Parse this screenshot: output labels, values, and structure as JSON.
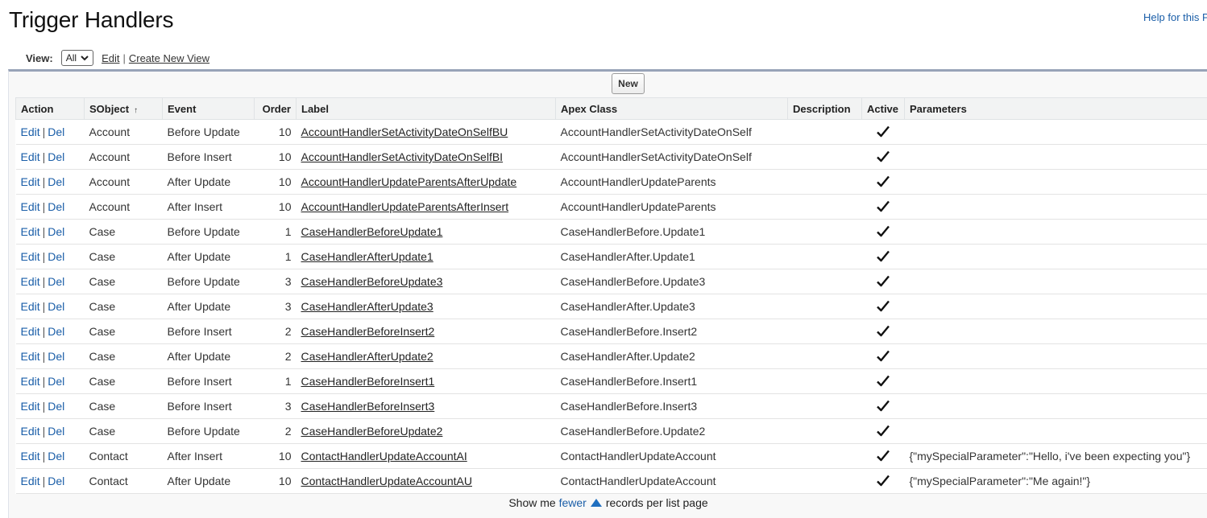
{
  "page": {
    "title": "Trigger Handlers",
    "help_link": "Help for this Page"
  },
  "viewbar": {
    "label": "View:",
    "selected": "All",
    "edit_link": "Edit",
    "separator": "|",
    "create_link": "Create New View"
  },
  "toolbar": {
    "new_label": "New"
  },
  "columns": {
    "action": "Action",
    "sobject": "SObject",
    "event": "Event",
    "order": "Order",
    "label": "Label",
    "apex_class": "Apex Class",
    "description": "Description",
    "active": "Active",
    "parameters": "Parameters"
  },
  "row_actions": {
    "edit": "Edit",
    "sep": "|",
    "del": "Del"
  },
  "rows": [
    {
      "sobject": "Account",
      "event": "Before Update",
      "order": "10",
      "label": "AccountHandlerSetActivityDateOnSelfBU",
      "apex_class": "AccountHandlerSetActivityDateOnSelf",
      "description": "",
      "active": true,
      "parameters": ""
    },
    {
      "sobject": "Account",
      "event": "Before Insert",
      "order": "10",
      "label": "AccountHandlerSetActivityDateOnSelfBI",
      "apex_class": "AccountHandlerSetActivityDateOnSelf",
      "description": "",
      "active": true,
      "parameters": ""
    },
    {
      "sobject": "Account",
      "event": "After Update",
      "order": "10",
      "label": "AccountHandlerUpdateParentsAfterUpdate",
      "apex_class": "AccountHandlerUpdateParents",
      "description": "",
      "active": true,
      "parameters": ""
    },
    {
      "sobject": "Account",
      "event": "After Insert",
      "order": "10",
      "label": "AccountHandlerUpdateParentsAfterInsert",
      "apex_class": "AccountHandlerUpdateParents",
      "description": "",
      "active": true,
      "parameters": ""
    },
    {
      "sobject": "Case",
      "event": "Before Update",
      "order": "1",
      "label": "CaseHandlerBeforeUpdate1",
      "apex_class": "CaseHandlerBefore.Update1",
      "description": "",
      "active": true,
      "parameters": ""
    },
    {
      "sobject": "Case",
      "event": "After Update",
      "order": "1",
      "label": "CaseHandlerAfterUpdate1",
      "apex_class": "CaseHandlerAfter.Update1",
      "description": "",
      "active": true,
      "parameters": ""
    },
    {
      "sobject": "Case",
      "event": "Before Update",
      "order": "3",
      "label": "CaseHandlerBeforeUpdate3",
      "apex_class": "CaseHandlerBefore.Update3",
      "description": "",
      "active": true,
      "parameters": ""
    },
    {
      "sobject": "Case",
      "event": "After Update",
      "order": "3",
      "label": "CaseHandlerAfterUpdate3",
      "apex_class": "CaseHandlerAfter.Update3",
      "description": "",
      "active": true,
      "parameters": ""
    },
    {
      "sobject": "Case",
      "event": "Before Insert",
      "order": "2",
      "label": "CaseHandlerBeforeInsert2",
      "apex_class": "CaseHandlerBefore.Insert2",
      "description": "",
      "active": true,
      "parameters": ""
    },
    {
      "sobject": "Case",
      "event": "After Update",
      "order": "2",
      "label": "CaseHandlerAfterUpdate2",
      "apex_class": "CaseHandlerAfter.Update2",
      "description": "",
      "active": true,
      "parameters": ""
    },
    {
      "sobject": "Case",
      "event": "Before Insert",
      "order": "1",
      "label": "CaseHandlerBeforeInsert1",
      "apex_class": "CaseHandlerBefore.Insert1",
      "description": "",
      "active": true,
      "parameters": ""
    },
    {
      "sobject": "Case",
      "event": "Before Insert",
      "order": "3",
      "label": "CaseHandlerBeforeInsert3",
      "apex_class": "CaseHandlerBefore.Insert3",
      "description": "",
      "active": true,
      "parameters": ""
    },
    {
      "sobject": "Case",
      "event": "Before Update",
      "order": "2",
      "label": "CaseHandlerBeforeUpdate2",
      "apex_class": "CaseHandlerBefore.Update2",
      "description": "",
      "active": true,
      "parameters": ""
    },
    {
      "sobject": "Contact",
      "event": "After Insert",
      "order": "10",
      "label": "ContactHandlerUpdateAccountAI",
      "apex_class": "ContactHandlerUpdateAccount",
      "description": "",
      "active": true,
      "parameters": "{\"mySpecialParameter\":\"Hello, i've been expecting you\"}"
    },
    {
      "sobject": "Contact",
      "event": "After Update",
      "order": "10",
      "label": "ContactHandlerUpdateAccountAU",
      "apex_class": "ContactHandlerUpdateAccount",
      "description": "",
      "active": true,
      "parameters": "{\"mySpecialParameter\":\"Me again!\"}"
    }
  ],
  "pager": {
    "prefix": "Show me",
    "link": "fewer",
    "suffix": "records per list page"
  },
  "colors": {
    "link": "#1a5ea8",
    "header_bg": "#f2f3f3",
    "list_border": "#98a3b8"
  }
}
